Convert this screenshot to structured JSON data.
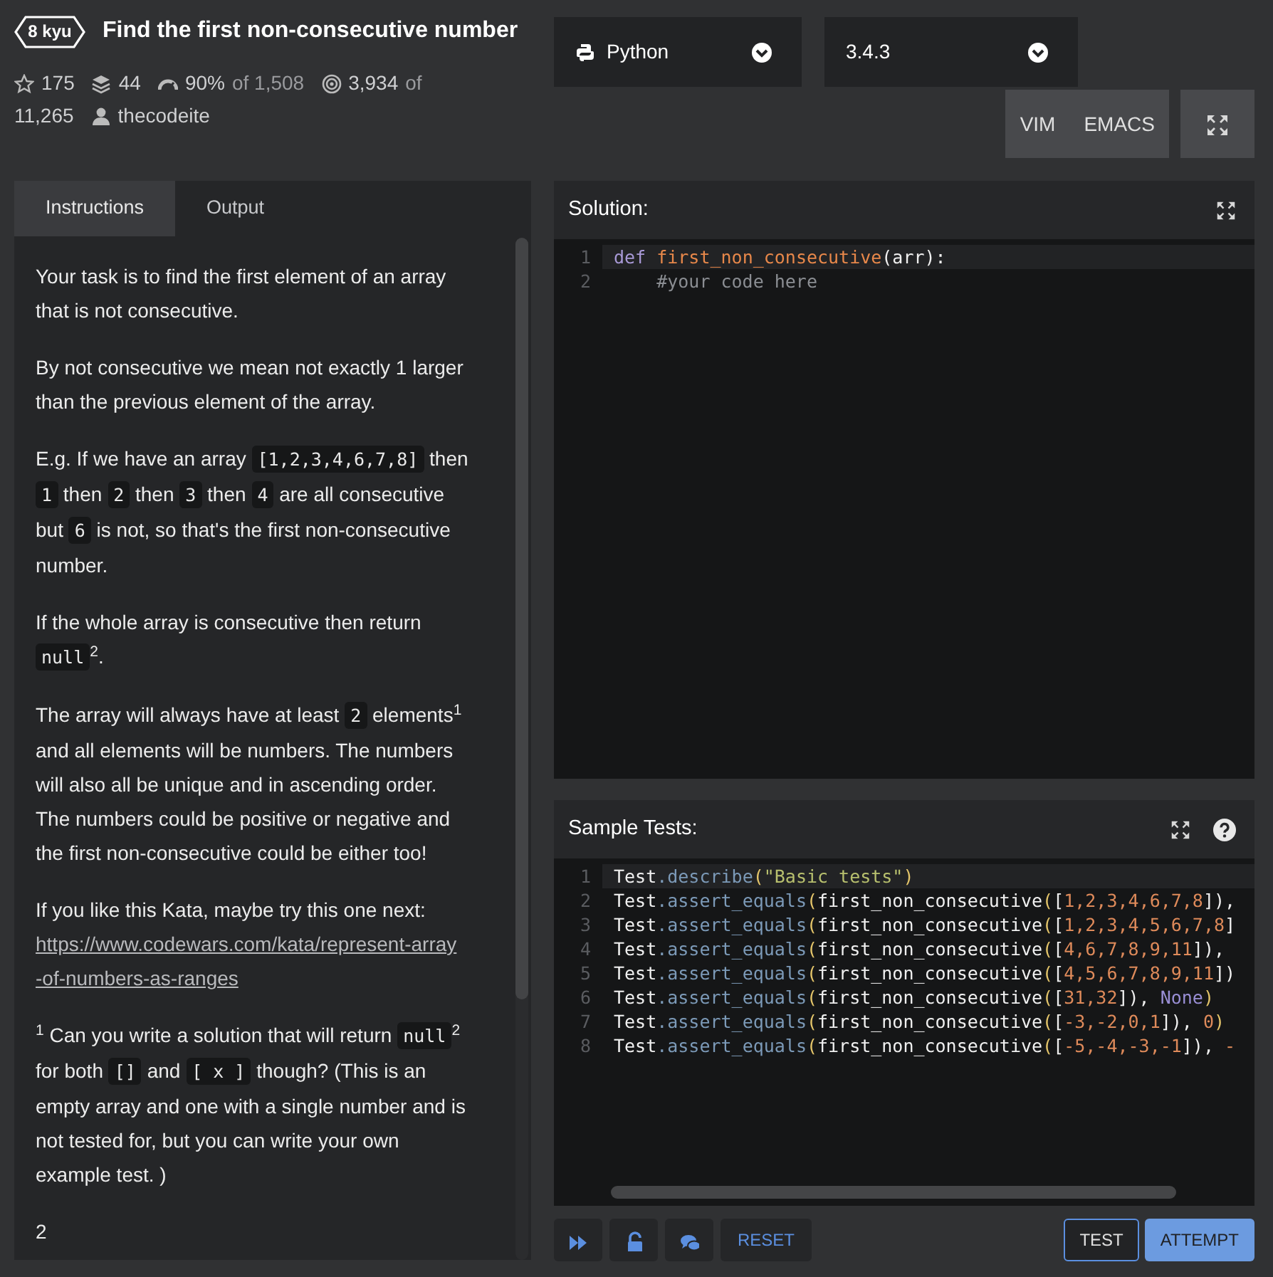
{
  "kata": {
    "rank": "8 kyu",
    "title": "Find the first non-consecutive number",
    "stats": [
      {
        "kind": "stars",
        "value": "175"
      },
      {
        "kind": "collections",
        "value": "44"
      },
      {
        "kind": "satisfaction",
        "value": "90%",
        "suffix": "of 1,508"
      },
      {
        "kind": "completed",
        "value": "3,934",
        "suffix": "of",
        "total": "11,265"
      },
      {
        "kind": "author",
        "value": "thecodeite"
      }
    ]
  },
  "language": {
    "value": "Python"
  },
  "version": {
    "value": "3.4.3"
  },
  "editor_modes": [
    "VIM",
    "EMACS"
  ],
  "tabs": [
    {
      "label": "Instructions",
      "selected": true
    },
    {
      "label": "Output",
      "selected": false
    }
  ],
  "description": [
    [
      {
        "kind": "text",
        "text": "Your task is to find the first element of an array that is not consecutive."
      }
    ],
    [
      {
        "kind": "text",
        "text": "By not consecutive we mean not exactly 1 larger than the previous element of the array."
      }
    ],
    [
      {
        "kind": "text",
        "text": "E.g. If we have an array "
      },
      {
        "kind": "code",
        "text": "[1,2,3,4,6,7,8]"
      },
      {
        "kind": "text",
        "text": " then "
      },
      {
        "kind": "code",
        "text": "1"
      },
      {
        "kind": "text",
        "text": " then "
      },
      {
        "kind": "code",
        "text": "2"
      },
      {
        "kind": "text",
        "text": " then "
      },
      {
        "kind": "code",
        "text": "3"
      },
      {
        "kind": "text",
        "text": " then "
      },
      {
        "kind": "code",
        "text": "4"
      },
      {
        "kind": "text",
        "text": " are all consecutive but "
      },
      {
        "kind": "code",
        "text": "6"
      },
      {
        "kind": "text",
        "text": " is not, so that's the first non-consecutive number."
      }
    ],
    [
      {
        "kind": "text",
        "text": "If the whole array is consecutive then return "
      },
      {
        "kind": "code",
        "text": "null"
      },
      {
        "kind": "text",
        "text": "$^{2}$."
      }
    ],
    [
      {
        "kind": "text",
        "text": "The array will always have at least "
      },
      {
        "kind": "code",
        "text": "2"
      },
      {
        "kind": "text",
        "text": " elements$^{1}$ and all elements will be numbers. The numbers will also all be unique and in ascending order. The numbers could be positive or negative and the first non-consecutive could be either too!"
      }
    ],
    [
      {
        "kind": "text",
        "text": "If you like this Kata, maybe try this one next: "
      },
      {
        "kind": "link",
        "text": "https://www.codewars.com/kata/represent-array-of-numbers-as-ranges"
      }
    ],
    [
      {
        "kind": "text",
        "text": "$^{1}$ Can you write a solution that will return "
      },
      {
        "kind": "code",
        "text": "null"
      },
      {
        "kind": "text",
        "text": "$^{2}$ for both "
      },
      {
        "kind": "code",
        "text": "[]"
      },
      {
        "kind": "text",
        "text": " and "
      },
      {
        "kind": "code",
        "text": "[ x ]"
      },
      {
        "kind": "text",
        "text": " though? (This is an empty array and one with a single number and is not tested for, but you can write your own example test. )"
      }
    ],
    [
      {
        "kind": "text",
        "text": "2"
      }
    ]
  ],
  "solution": {
    "title": "Solution:",
    "lines": [
      {
        "n": "1",
        "active": true,
        "tokens": [
          {
            "kind": "keyword",
            "text": "def "
          },
          {
            "kind": "fn",
            "text": "first_non_consecutive"
          },
          {
            "kind": "plain",
            "text": "(arr):"
          }
        ]
      },
      {
        "n": "2",
        "active": false,
        "tokens": [
          {
            "kind": "comment",
            "text": "    #your code here"
          }
        ]
      }
    ]
  },
  "sample_tests": {
    "title": "Sample Tests:",
    "lines": [
      {
        "n": "1",
        "active": true,
        "tokens": [
          {
            "kind": "plain",
            "text": "Test"
          },
          {
            "kind": "prop",
            "text": ".describe"
          },
          {
            "kind": "paren",
            "text": "("
          },
          {
            "kind": "string",
            "text": "\"Basic tests\""
          },
          {
            "kind": "paren",
            "text": ")"
          }
        ]
      },
      {
        "n": "2",
        "active": false,
        "tokens": [
          {
            "kind": "plain",
            "text": "Test"
          },
          {
            "kind": "prop",
            "text": ".assert_equals"
          },
          {
            "kind": "paren",
            "text": "("
          },
          {
            "kind": "plain",
            "text": "first_non_consecutive"
          },
          {
            "kind": "paren",
            "text": "("
          },
          {
            "kind": "plain",
            "text": "["
          },
          {
            "kind": "number",
            "text": "1,2,3,4,6,7,8"
          },
          {
            "kind": "plain",
            "text": "]),"
          }
        ]
      },
      {
        "n": "3",
        "active": false,
        "tokens": [
          {
            "kind": "plain",
            "text": "Test"
          },
          {
            "kind": "prop",
            "text": ".assert_equals"
          },
          {
            "kind": "paren",
            "text": "("
          },
          {
            "kind": "plain",
            "text": "first_non_consecutive"
          },
          {
            "kind": "paren",
            "text": "("
          },
          {
            "kind": "plain",
            "text": "["
          },
          {
            "kind": "number",
            "text": "1,2,3,4,5,6,7,8"
          },
          {
            "kind": "plain",
            "text": "]"
          }
        ]
      },
      {
        "n": "4",
        "active": false,
        "tokens": [
          {
            "kind": "plain",
            "text": "Test"
          },
          {
            "kind": "prop",
            "text": ".assert_equals"
          },
          {
            "kind": "paren",
            "text": "("
          },
          {
            "kind": "plain",
            "text": "first_non_consecutive"
          },
          {
            "kind": "paren",
            "text": "("
          },
          {
            "kind": "plain",
            "text": "["
          },
          {
            "kind": "number",
            "text": "4,6,7,8,9,11"
          },
          {
            "kind": "plain",
            "text": "]),"
          }
        ]
      },
      {
        "n": "5",
        "active": false,
        "tokens": [
          {
            "kind": "plain",
            "text": "Test"
          },
          {
            "kind": "prop",
            "text": ".assert_equals"
          },
          {
            "kind": "paren",
            "text": "("
          },
          {
            "kind": "plain",
            "text": "first_non_consecutive"
          },
          {
            "kind": "paren",
            "text": "("
          },
          {
            "kind": "plain",
            "text": "["
          },
          {
            "kind": "number",
            "text": "4,5,6,7,8,9,11"
          },
          {
            "kind": "plain",
            "text": "])"
          }
        ]
      },
      {
        "n": "6",
        "active": false,
        "tokens": [
          {
            "kind": "plain",
            "text": "Test"
          },
          {
            "kind": "prop",
            "text": ".assert_equals"
          },
          {
            "kind": "paren",
            "text": "("
          },
          {
            "kind": "plain",
            "text": "first_non_consecutive"
          },
          {
            "kind": "paren",
            "text": "("
          },
          {
            "kind": "plain",
            "text": "["
          },
          {
            "kind": "number",
            "text": "31,32"
          },
          {
            "kind": "plain",
            "text": "]), "
          },
          {
            "kind": "const",
            "text": "None"
          },
          {
            "kind": "paren",
            "text": ")"
          }
        ]
      },
      {
        "n": "7",
        "active": false,
        "tokens": [
          {
            "kind": "plain",
            "text": "Test"
          },
          {
            "kind": "prop",
            "text": ".assert_equals"
          },
          {
            "kind": "paren",
            "text": "("
          },
          {
            "kind": "plain",
            "text": "first_non_consecutive"
          },
          {
            "kind": "paren",
            "text": "("
          },
          {
            "kind": "plain",
            "text": "["
          },
          {
            "kind": "number",
            "text": "-3,-2,0,1"
          },
          {
            "kind": "plain",
            "text": "]), "
          },
          {
            "kind": "number",
            "text": "0"
          },
          {
            "kind": "paren",
            "text": ")"
          }
        ]
      },
      {
        "n": "8",
        "active": false,
        "tokens": [
          {
            "kind": "plain",
            "text": "Test"
          },
          {
            "kind": "prop",
            "text": ".assert_equals"
          },
          {
            "kind": "paren",
            "text": "("
          },
          {
            "kind": "plain",
            "text": "first_non_consecutive"
          },
          {
            "kind": "paren",
            "text": "("
          },
          {
            "kind": "plain",
            "text": "["
          },
          {
            "kind": "number",
            "text": "-5,-4,-3,-1"
          },
          {
            "kind": "plain",
            "text": "]), "
          },
          {
            "kind": "number",
            "text": "-"
          }
        ]
      }
    ]
  },
  "actions_left": [
    {
      "kind": "skip"
    },
    {
      "kind": "unlock"
    },
    {
      "kind": "discuss"
    },
    {
      "kind": "text",
      "label": "RESET"
    }
  ],
  "actions_right": [
    {
      "kind": "outline",
      "label": "TEST"
    },
    {
      "kind": "primary",
      "label": "ATTEMPT"
    }
  ]
}
